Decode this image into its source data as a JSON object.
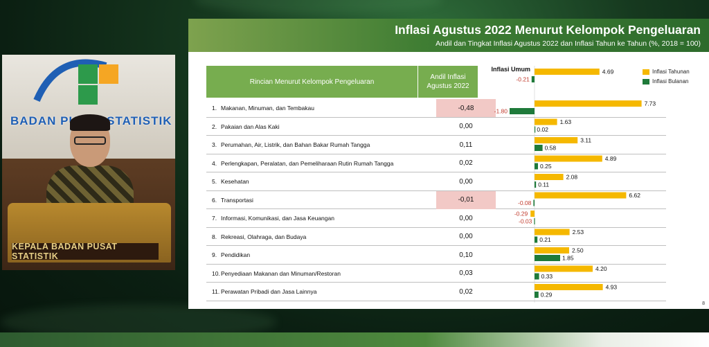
{
  "slide": {
    "title": "Inflasi Agustus 2022 Menurut Kelompok Pengeluaran",
    "subtitle": "Andil dan Tingkat Inflasi Agustus 2022 dan Inflasi Tahun ke Tahun (%, 2018 = 100)",
    "page_number": "8"
  },
  "table": {
    "header_left": "Rincian Menurut Kelompok Pengeluaran",
    "header_right": "Andil Inflasi Agustus 2022",
    "rows": [
      {
        "num": "1.",
        "label": "Makanan, Minuman, dan Tembakau",
        "andil": "-0,48",
        "negative": true
      },
      {
        "num": "2.",
        "label": "Pakaian dan Alas Kaki",
        "andil": "0,00",
        "negative": false
      },
      {
        "num": "3.",
        "label": "Perumahan, Air, Listrik, dan Bahan Bakar Rumah Tangga",
        "andil": "0,11",
        "negative": false
      },
      {
        "num": "4.",
        "label": "Perlengkapan, Peralatan, dan Pemeliharaan Rutin Rumah Tangga",
        "andil": "0,02",
        "negative": false
      },
      {
        "num": "5.",
        "label": "Kesehatan",
        "andil": "0,00",
        "negative": false
      },
      {
        "num": "6.",
        "label": "Transportasi",
        "andil": "-0,01",
        "negative": true
      },
      {
        "num": "7.",
        "label": "Informasi, Komunikasi, dan Jasa Keuangan",
        "andil": "0,00",
        "negative": false
      },
      {
        "num": "8.",
        "label": "Rekreasi, Olahraga, dan Budaya",
        "andil": "0,00",
        "negative": false
      },
      {
        "num": "9.",
        "label": "Pendidikan",
        "andil": "0,10",
        "negative": false
      },
      {
        "num": "10.",
        "label": "Penyediaan Makanan dan Minuman/Restoran",
        "andil": "0,03",
        "negative": false
      },
      {
        "num": "11.",
        "label": "Perawatan Pribadi dan Jasa Lainnya",
        "andil": "0,02",
        "negative": false
      }
    ]
  },
  "video": {
    "logo_text": "BADAN PUSAT STATISTIK",
    "podium_text": "KEPALA BADAN PUSAT STATISTIK"
  },
  "colors": {
    "yoy": "#f5b800",
    "mtm": "#1f7a3a",
    "negative_text": "#c0392b"
  },
  "chart_data": {
    "type": "bar",
    "orientation": "horizontal",
    "categories": [
      "Inflasi Umum",
      "1.",
      "2.",
      "3.",
      "4.",
      "5.",
      "6.",
      "7.",
      "8.",
      "9.",
      "10.",
      "11."
    ],
    "series": [
      {
        "name": "Inflasi Tahunan",
        "values": [
          4.69,
          7.73,
          1.63,
          3.11,
          4.89,
          2.08,
          6.62,
          -0.29,
          2.53,
          2.5,
          4.2,
          4.93
        ],
        "labels": [
          "4.69",
          "7.73",
          "1.63",
          "3.11",
          "4.89",
          "2.08",
          "6.62",
          "-0.29",
          "2.53",
          "2.50",
          "4.20",
          "4.93"
        ]
      },
      {
        "name": "Inflasi Bulanan",
        "values": [
          -0.21,
          -1.8,
          0.02,
          0.58,
          0.25,
          0.11,
          -0.08,
          -0.03,
          0.21,
          1.85,
          0.33,
          0.29
        ],
        "labels": [
          "-0.21",
          "-1.80",
          "0.02",
          "0.58",
          "0.25",
          "0.11",
          "-0.08",
          "-0.03",
          "0.21",
          "1.85",
          "0.33",
          "0.29"
        ]
      }
    ],
    "legend": "top-right"
  }
}
